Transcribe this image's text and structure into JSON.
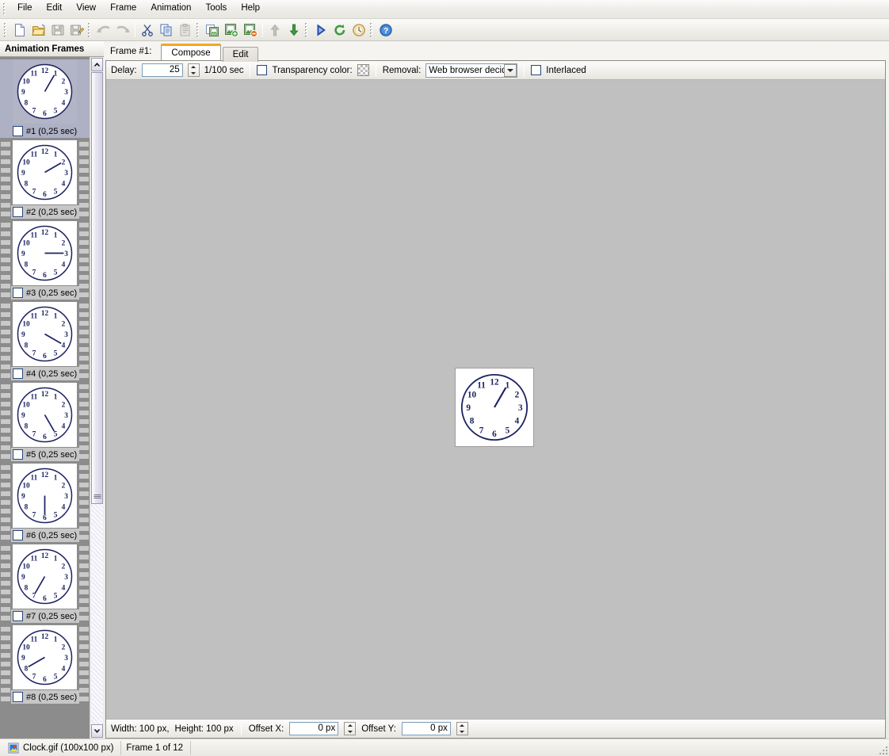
{
  "app": {
    "title": "Animation Frames"
  },
  "menu": {
    "items": [
      {
        "label": "File",
        "name": "menu-file"
      },
      {
        "label": "Edit",
        "name": "menu-edit"
      },
      {
        "label": "View",
        "name": "menu-view"
      },
      {
        "label": "Frame",
        "name": "menu-frame"
      },
      {
        "label": "Animation",
        "name": "menu-animation"
      },
      {
        "label": "Tools",
        "name": "menu-tools"
      },
      {
        "label": "Help",
        "name": "menu-help"
      }
    ]
  },
  "toolbar": {
    "groups": [
      {
        "buttons": [
          {
            "icon": "new-file-icon",
            "title": "New"
          },
          {
            "icon": "open-folder-icon",
            "title": "Open"
          },
          {
            "icon": "save-disk-icon",
            "title": "Save",
            "disabled": true
          },
          {
            "icon": "save-as-icon",
            "title": "Save As"
          }
        ]
      },
      {
        "buttons": [
          {
            "icon": "undo-arrow-icon",
            "title": "Undo",
            "disabled": true
          },
          {
            "icon": "redo-arrow-icon",
            "title": "Redo",
            "disabled": true
          }
        ]
      },
      {
        "buttons": [
          {
            "icon": "cut-scissors-icon",
            "title": "Cut"
          },
          {
            "icon": "copy-pages-icon",
            "title": "Copy"
          },
          {
            "icon": "paste-clipboard-icon",
            "title": "Paste",
            "disabled": true
          }
        ]
      },
      {
        "buttons": [
          {
            "icon": "frame-duplicate-icon",
            "title": "Duplicate Frame"
          },
          {
            "icon": "frame-add-icon",
            "title": "Add Frame"
          },
          {
            "icon": "frame-delete-icon",
            "title": "Delete Frame"
          },
          {
            "icon": "move-up-arrow-icon",
            "title": "Move Up",
            "disabled": true
          },
          {
            "icon": "move-down-arrow-icon",
            "title": "Move Down"
          }
        ]
      },
      {
        "buttons": [
          {
            "icon": "play-triangle-icon",
            "title": "Play"
          },
          {
            "icon": "loop-arrow-icon",
            "title": "Loop"
          },
          {
            "icon": "timer-clock-icon",
            "title": "Timing"
          }
        ]
      },
      {
        "buttons": [
          {
            "icon": "help-question-icon",
            "title": "Help"
          }
        ]
      }
    ]
  },
  "frames_panel": {
    "header": "Animation Frames",
    "selected_index": 0,
    "frames": [
      {
        "label": "#1 (0,25 sec)",
        "hand_hour": 1,
        "checked": false
      },
      {
        "label": "#2 (0,25 sec)",
        "hand_hour": 2,
        "checked": false
      },
      {
        "label": "#3 (0,25 sec)",
        "hand_hour": 3,
        "checked": false
      },
      {
        "label": "#4 (0,25 sec)",
        "hand_hour": 4,
        "checked": false
      },
      {
        "label": "#5 (0,25 sec)",
        "hand_hour": 5,
        "checked": false
      },
      {
        "label": "#6 (0,25 sec)",
        "hand_hour": 6,
        "checked": false
      },
      {
        "label": "#7 (0,25 sec)",
        "hand_hour": 7,
        "checked": false
      },
      {
        "label": "#8 (0,25 sec)",
        "hand_hour": 8,
        "checked": false
      }
    ]
  },
  "editor": {
    "frame_prefix": "Frame #1:",
    "tabs": [
      {
        "label": "Compose",
        "active": true
      },
      {
        "label": "Edit",
        "active": false
      }
    ],
    "options": {
      "delay_label": "Delay:",
      "delay_value": "25",
      "delay_units": "1/100 sec",
      "transparency_label": "Transparency color:",
      "transparency_checked": false,
      "removal_label": "Removal:",
      "removal_value": "Web browser decide",
      "interlaced_label": "Interlaced",
      "interlaced_checked": false
    },
    "canvas": {
      "hand_hour": 1,
      "accent_color": "#1b2260"
    },
    "geometry": {
      "width_label": "Width: 100 px,",
      "height_label": "Height: 100 px",
      "offset_x_label": "Offset X:",
      "offset_x_value": "0 px",
      "offset_y_label": "Offset Y:",
      "offset_y_value": "0 px"
    }
  },
  "statusbar": {
    "file_label": "Clock.gif (100x100 px)",
    "frame_label": "Frame 1 of 12",
    "file_icon": "image-file-icon"
  },
  "colors": {
    "tab_accent": "#f5a623",
    "canvas_bg": "#c0c0c0",
    "clock_ink": "#1b2260",
    "selection": "#aeb0c4"
  }
}
